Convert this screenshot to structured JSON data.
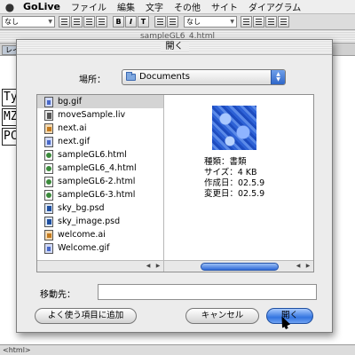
{
  "menubar": {
    "app_name": "GoLive",
    "items": [
      "ファイル",
      "編集",
      "文字",
      "その他",
      "サイト",
      "ダイアグラム"
    ]
  },
  "toolbar": {
    "style_select": "なし",
    "font_select": "なし",
    "buttons": [
      "B",
      "I",
      "T"
    ]
  },
  "document": {
    "title": "sampleGL6_4.html",
    "tab_label": "レイ",
    "fragments": [
      "Ty",
      "MZ",
      "PC"
    ],
    "status": "<html>"
  },
  "dialog": {
    "title": "開く",
    "location_label": "場所：",
    "location_value": "Documents",
    "files": [
      {
        "name": "bg.gif",
        "icon": "gif-file-icon",
        "selected": true
      },
      {
        "name": "moveSample.liv",
        "icon": "liv-file-icon"
      },
      {
        "name": "next.ai",
        "icon": "illustrator-file-icon"
      },
      {
        "name": "next.gif",
        "icon": "gif-file-icon"
      },
      {
        "name": "sampleGL6.html",
        "icon": "html-file-icon"
      },
      {
        "name": "sampleGL6_4.html",
        "icon": "html-file-icon"
      },
      {
        "name": "sampleGL6-2.html",
        "icon": "html-file-icon"
      },
      {
        "name": "sampleGL6-3.html",
        "icon": "html-file-icon"
      },
      {
        "name": "sky_bg.psd",
        "icon": "psd-file-icon"
      },
      {
        "name": "sky_image.psd",
        "icon": "psd-file-icon"
      },
      {
        "name": "welcome.ai",
        "icon": "illustrator-file-icon"
      },
      {
        "name": "Welcome.gif",
        "icon": "gif-file-icon"
      }
    ],
    "preview": {
      "kind": "種類：書類",
      "size": "サイズ：4 KB",
      "created": "作成日：02.5.9",
      "modified": "変更日：02.5.9"
    },
    "destination_label": "移動先：",
    "destination_value": "",
    "favorite_button": "よく使う項目に追加",
    "cancel_button": "キャンセル",
    "open_button": "開く"
  },
  "colors": {
    "accent": "#3475e0",
    "selection": "#d4d4d4"
  }
}
